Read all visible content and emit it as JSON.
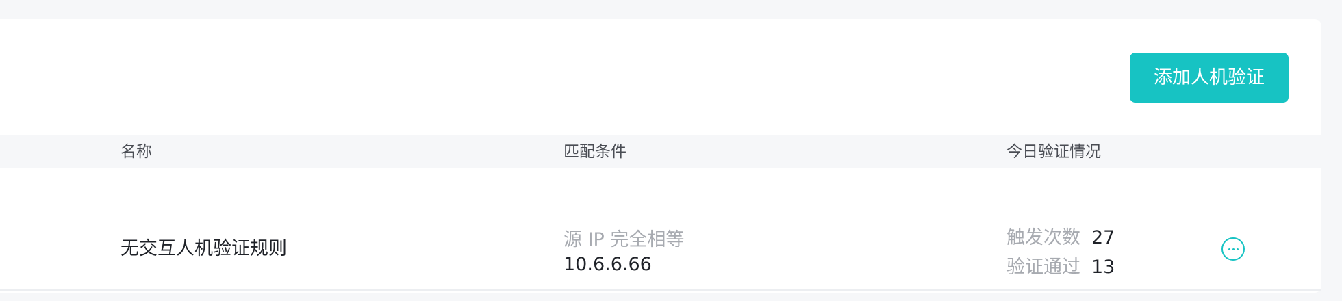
{
  "toolbar": {
    "add_button_label": "添加人机验证"
  },
  "table": {
    "columns": [
      "名称",
      "匹配条件",
      "今日验证情况"
    ],
    "rows": [
      {
        "name": "无交互人机验证规则",
        "condition_label": "源 IP 完全相等",
        "condition_value": "10.6.6.66",
        "stats": [
          {
            "label": "触发次数",
            "value": "27"
          },
          {
            "label": "验证通过",
            "value": "13"
          }
        ],
        "action_icon": "more-icon"
      }
    ]
  },
  "colors": {
    "accent": "#17c3c3",
    "page_bg": "#f6f7f9",
    "muted_text": "#a7aab0"
  }
}
